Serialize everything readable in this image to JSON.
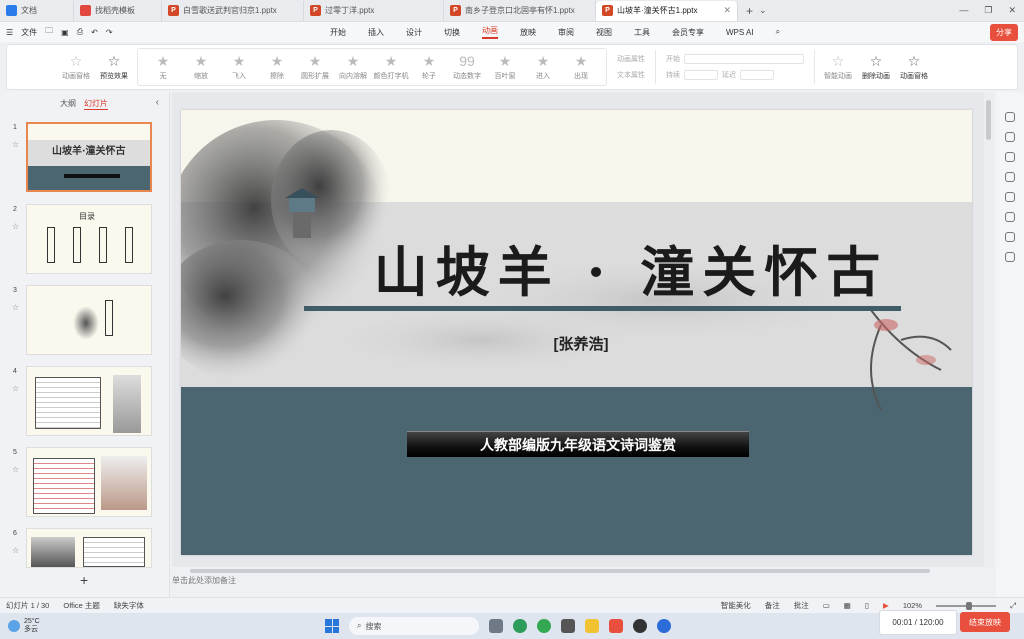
{
  "tabs": [
    {
      "label": "文档",
      "icon": "home-icon",
      "kind": "w"
    },
    {
      "label": "找稻壳模板",
      "icon": "template-icon",
      "kind": "c"
    },
    {
      "label": "白雪歌送武判官归京1.pptx",
      "icon": "ppt-icon",
      "kind": "p"
    },
    {
      "label": "过零丁洋.pptx",
      "icon": "ppt-icon",
      "kind": "p"
    },
    {
      "label": "南乡子登京口北固亭有怀1.pptx",
      "icon": "ppt-icon",
      "kind": "p"
    },
    {
      "label": "山坡羊·潼关怀古1.pptx",
      "icon": "ppt-icon",
      "kind": "p",
      "active": true
    }
  ],
  "menubar": {
    "file": "文件",
    "items": [
      "开始",
      "插入",
      "设计",
      "切换",
      "动画",
      "放映",
      "审阅",
      "视图",
      "工具",
      "会员专享"
    ],
    "active": "动画",
    "wps_ai": "WPS AI",
    "share": "分享"
  },
  "ribbon": {
    "preview": "动画窗格",
    "play": "预览效果",
    "effects": [
      "无",
      "缩放",
      "飞入",
      "擦除",
      "圆形扩展",
      "向内溶解",
      "颜色打字机",
      "轮子",
      "动态数字",
      "百叶窗",
      "进入",
      "出现"
    ],
    "effect_options": "动画属性",
    "text_props": "文本属性",
    "start": "开始",
    "duration": "持续",
    "delay": "延迟",
    "smart": "智能动画",
    "delete": "删除动画",
    "pane": "动画窗格"
  },
  "sidebar": {
    "tab_outline": "大纲",
    "tab_slides": "幻灯片",
    "slides": [
      "1",
      "2",
      "3",
      "4",
      "5",
      "6"
    ]
  },
  "slide": {
    "title": "山坡羊 · 潼关怀古",
    "author": "[张养浩]",
    "subtitle": "人教部编版九年级语文诗词鉴赏"
  },
  "thumbs": {
    "t1_title": "山坡羊·潼关怀古",
    "t2_title": "目录"
  },
  "notes": "单击此处添加备注",
  "status": {
    "slide_no": "幻灯片 1 / 30",
    "theme": "Office 主题",
    "missing_font": "缺失字体",
    "beautify": "智能美化",
    "notes": "备注",
    "comment": "批注",
    "zoom": "102%"
  },
  "taskbar": {
    "temp": "25°C",
    "weather": "多云",
    "search": "搜索"
  },
  "timer": "00:01 / 120:00",
  "end_show": "结束放映"
}
